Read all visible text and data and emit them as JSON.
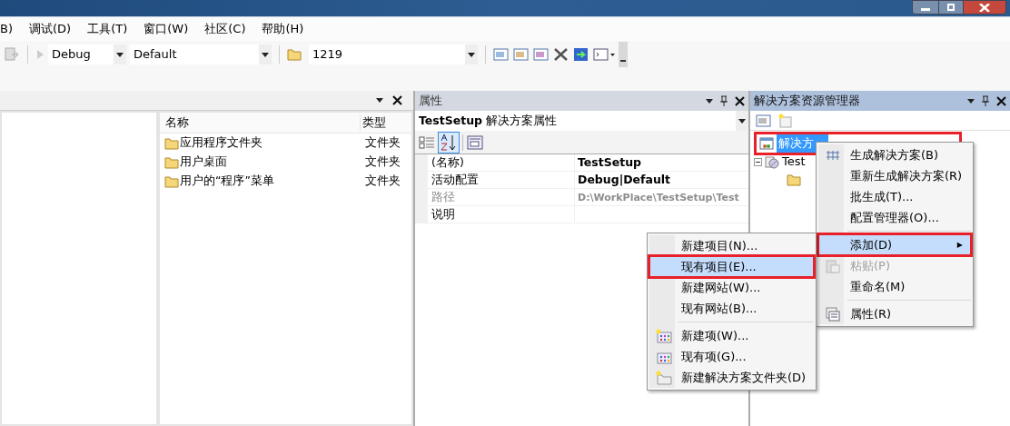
{
  "menu_bar": [
    "B)",
    "调试(D)",
    "工具(T)",
    "窗口(W)",
    "社区(C)",
    "帮助(H)"
  ],
  "toolbar": {
    "configuration": "Debug",
    "platform": "Default",
    "startup": "1219"
  },
  "left_panel": {
    "columns": [
      "名称",
      "类型"
    ],
    "rows": [
      {
        "name": "应用程序文件夹",
        "type": "文件夹"
      },
      {
        "name": "用户桌面",
        "type": "文件夹"
      },
      {
        "name": "用户的“程序”菜单",
        "type": "文件夹"
      }
    ]
  },
  "properties": {
    "title": "属性",
    "object": "**TestSetup** 解决方案属性",
    "sort_alphabetical": true,
    "rows": [
      {
        "name": "(名称)",
        "value": "TestSetup",
        "disabled": false
      },
      {
        "name": "活动配置",
        "value": "Debug|Default",
        "disabled": false
      },
      {
        "name": "路径",
        "value": "D:\\WorkPlace\\TestSetup\\Test",
        "disabled": true
      },
      {
        "name": "说明",
        "disabled": false
      }
    ]
  },
  "solution_explorer": {
    "title": "解决方案资源管理器",
    "tree": [
      {
        "label": "解决方",
        "selected": true,
        "annotated": true,
        "children": [
          {
            "label": "Test",
            "selected": false,
            "expanded": true,
            "children": [
              {
                "kind": "folder"
              }
            ]
          }
        ]
      }
    ]
  },
  "context_menu": [
    {
      "kind": "item",
      "label": "生成解决方案(B)",
      "selected": false,
      "annotated": false,
      "disabled": false
    },
    {
      "kind": "item",
      "label": "重新生成解决方案(R)",
      "selected": false,
      "annotated": false,
      "disabled": false
    },
    {
      "kind": "item",
      "label": "批生成(T)...",
      "selected": false,
      "annotated": false,
      "disabled": false
    },
    {
      "kind": "item",
      "label": "配置管理器(O)...",
      "selected": false,
      "annotated": false,
      "disabled": false
    },
    {
      "kind": "separator"
    },
    {
      "kind": "submenu",
      "label": "添加(D)",
      "arrow": "▶",
      "selected": true,
      "annotated": true,
      "disabled": false
    },
    {
      "kind": "item",
      "label": "粘贴(P)",
      "selected": false,
      "annotated": false,
      "disabled": true
    },
    {
      "kind": "item",
      "label": "重命名(M)",
      "selected": false,
      "annotated": false,
      "disabled": false
    },
    {
      "kind": "separator"
    },
    {
      "kind": "item",
      "label": "属性(R)",
      "selected": false,
      "annotated": false,
      "disabled": false
    }
  ],
  "submenu": [
    {
      "kind": "item",
      "label": "新建项目(N)...",
      "selected": false,
      "annotated": false,
      "disabled": false
    },
    {
      "kind": "item",
      "label": "现有项目(E)...",
      "selected": true,
      "annotated": true,
      "disabled": false
    },
    {
      "kind": "item",
      "label": "新建网站(W)...",
      "selected": false,
      "annotated": false,
      "disabled": false
    },
    {
      "kind": "item",
      "label": "现有网站(B)...",
      "selected": false,
      "annotated": false,
      "disabled": false
    },
    {
      "kind": "separator"
    },
    {
      "kind": "item",
      "label": "新建项(W)...",
      "selected": false,
      "annotated": false,
      "disabled": false
    },
    {
      "kind": "item",
      "label": "现有项(G)...",
      "selected": false,
      "annotated": false,
      "disabled": false
    },
    {
      "kind": "item",
      "label": "新建解决方案文件夹(D)",
      "selected": false,
      "annotated": false,
      "disabled": false
    }
  ]
}
